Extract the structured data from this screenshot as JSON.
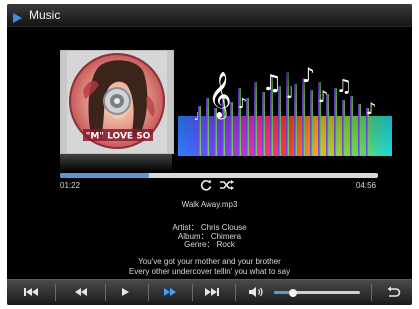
{
  "window": {
    "title": "Music"
  },
  "album": {
    "cover_text": "\"M\" LOVE SO",
    "icon": "album-cover"
  },
  "playback": {
    "current_time": "01:22",
    "total_time": "04:56",
    "progress": 0.28
  },
  "track": {
    "filename": "Walk Away.mp3",
    "artist_line": "Artist： Chris Clouse",
    "album_line": "Album： Chimera",
    "genre_line": "Genre： Rock"
  },
  "lyrics": {
    "line1": "You've got your mother and your brother",
    "line2": "Every other undercover tellin' you what to say"
  },
  "controls": {
    "icons": [
      "skip-previous-icon",
      "rewind-icon",
      "play-icon",
      "fast-forward-icon",
      "skip-next-icon",
      "volume-icon",
      "back-icon"
    ],
    "volume": 0.22
  },
  "colors": {
    "accent": "#5d97d0",
    "background": "#000000",
    "text": "#d8d8d8"
  }
}
